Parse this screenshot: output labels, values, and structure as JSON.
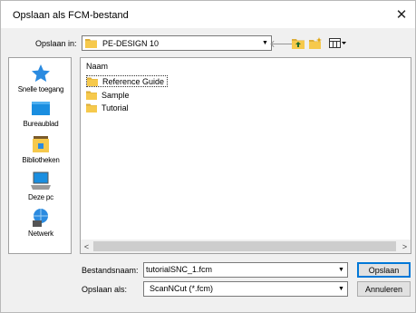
{
  "window": {
    "title": "Opslaan als FCM-bestand",
    "close_glyph": "✕"
  },
  "lookin": {
    "label": "Opslaan in:",
    "value": "PE-DESIGN 10"
  },
  "toolbar": {
    "back_icon": "back-arrow-icon",
    "up_icon": "up-folder-icon",
    "new_folder_icon": "new-folder-icon",
    "view_icon": "view-menu-icon"
  },
  "sidebar": {
    "items": [
      {
        "label": "Snelle toegang",
        "icon": "star-icon"
      },
      {
        "label": "Bureaublad",
        "icon": "desktop-icon"
      },
      {
        "label": "Bibliotheken",
        "icon": "library-icon"
      },
      {
        "label": "Deze pc",
        "icon": "computer-icon"
      },
      {
        "label": "Netwerk",
        "icon": "network-icon"
      }
    ]
  },
  "filelist": {
    "column_header": "Naam",
    "items": [
      {
        "name": "Reference Guide",
        "type": "folder"
      },
      {
        "name": "Sample",
        "type": "folder"
      },
      {
        "name": "Tutorial",
        "type": "folder"
      }
    ],
    "scroll_left": "<",
    "scroll_right": ">"
  },
  "form": {
    "filename_label": "Bestandsnaam:",
    "filename_value": "tutorialSNC_1.fcm",
    "type_label": "Opslaan als:",
    "type_value": "ScanNCut (*.fcm)"
  },
  "buttons": {
    "save": "Opslaan",
    "cancel": "Annuleren"
  },
  "colors": {
    "accent": "#0078d7",
    "folder": "#f6c94c"
  }
}
